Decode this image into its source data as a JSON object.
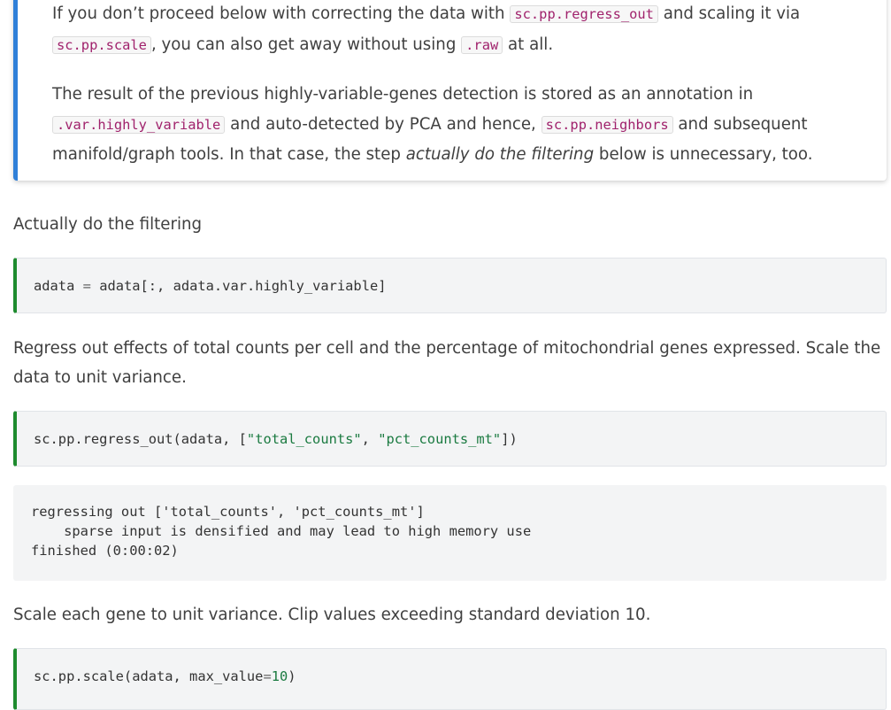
{
  "note": {
    "p1": {
      "t1": "If you don’t proceed below with correcting the data with ",
      "c1": "sc.pp.regress_out",
      "t2": " and scaling it via",
      "c2": "sc.pp.scale",
      "t3": ", you can also get away without using ",
      "c3": ".raw",
      "t4": " at all."
    },
    "p2": {
      "t1": "The result of the previous highly-variable-genes detection is stored as an annotation in",
      "c1": ".var.highly_variable",
      "t2": " and auto-detected by PCA and hence, ",
      "c2": "sc.pp.neighbors",
      "t3": " and subsequent",
      "t4": "manifold/graph tools. In that case, the step ",
      "em": "actually do the filtering",
      "t5": " below is unnecessary, too."
    }
  },
  "heading_filtering": "Actually do the filtering",
  "cell1": {
    "a": "adata",
    "eq": "=",
    "b": "adata[:, adata.var.highly_variable]"
  },
  "para_regress": "Regress out effects of total counts per cell and the percentage of mitochondrial genes expressed. Scale the data to unit variance.",
  "cell2": {
    "a": "sc.pp.regress_out(adata, [",
    "s1": "\"total_counts\"",
    "comma": ", ",
    "s2": "\"pct_counts_mt\"",
    "b": "])"
  },
  "output1": "regressing out ['total_counts', 'pct_counts_mt']\n    sparse input is densified and may lead to high memory use\nfinished (0:00:02)",
  "para_scale": "Scale each gene to unit variance. Clip values exceeding standard deviation 10.",
  "cell3": {
    "a": "sc.pp.scale(adata, max_value",
    "eq": "=",
    "num": "10",
    "b": ")"
  }
}
